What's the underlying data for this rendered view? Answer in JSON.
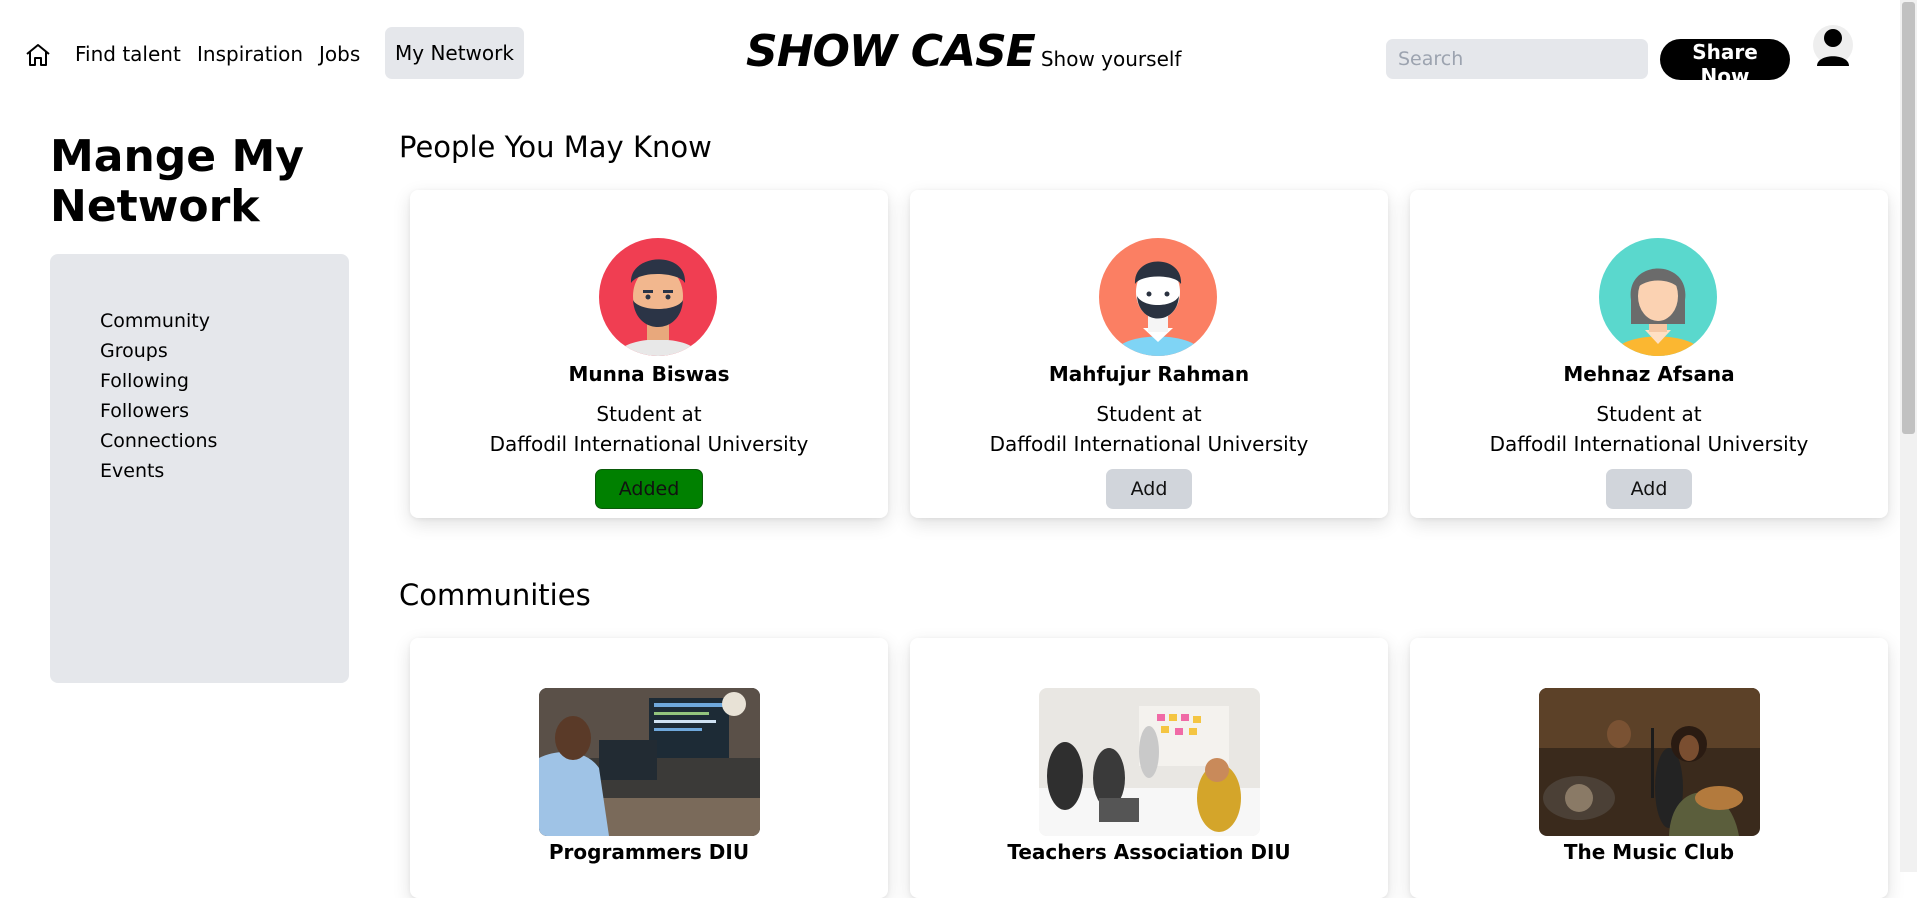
{
  "nav": {
    "links": [
      {
        "label": "Find talent"
      },
      {
        "label": "Inspiration"
      },
      {
        "label": "Jobs"
      },
      {
        "label": "My Network",
        "active": true
      }
    ],
    "brand_title": "SHOW CASE",
    "brand_tagline": "Show yourself",
    "search_placeholder": "Search",
    "share_label": "Share Now",
    "icons": {
      "home": "home-icon",
      "profile": "user-icon"
    }
  },
  "sidebar": {
    "title": "Mange My Network",
    "items": [
      {
        "label": "Community"
      },
      {
        "label": "Groups"
      },
      {
        "label": "Following"
      },
      {
        "label": "Followers"
      },
      {
        "label": "Connections"
      },
      {
        "label": "Events"
      }
    ]
  },
  "people_section": {
    "title": "People You May Know",
    "people": [
      {
        "name": "Munna Biswas",
        "role": "Student at",
        "org": "Daffodil International University",
        "button": "Added",
        "status": "added"
      },
      {
        "name": "Mahfujur Rahman",
        "role": "Student at",
        "org": "Daffodil International University",
        "button": "Add",
        "status": "not-added"
      },
      {
        "name": "Mehnaz Afsana",
        "role": "Student at",
        "org": "Daffodil International University",
        "button": "Add",
        "status": "not-added"
      }
    ]
  },
  "communities_section": {
    "title": "Communities",
    "items": [
      {
        "name": "Programmers DIU"
      },
      {
        "name": "Teachers Association DIU"
      },
      {
        "name": "The Music Club"
      }
    ]
  },
  "colors": {
    "added_button": "#008000",
    "add_button": "#d1d5db",
    "panel": "#e5e7eb",
    "share_button": "#000000"
  }
}
